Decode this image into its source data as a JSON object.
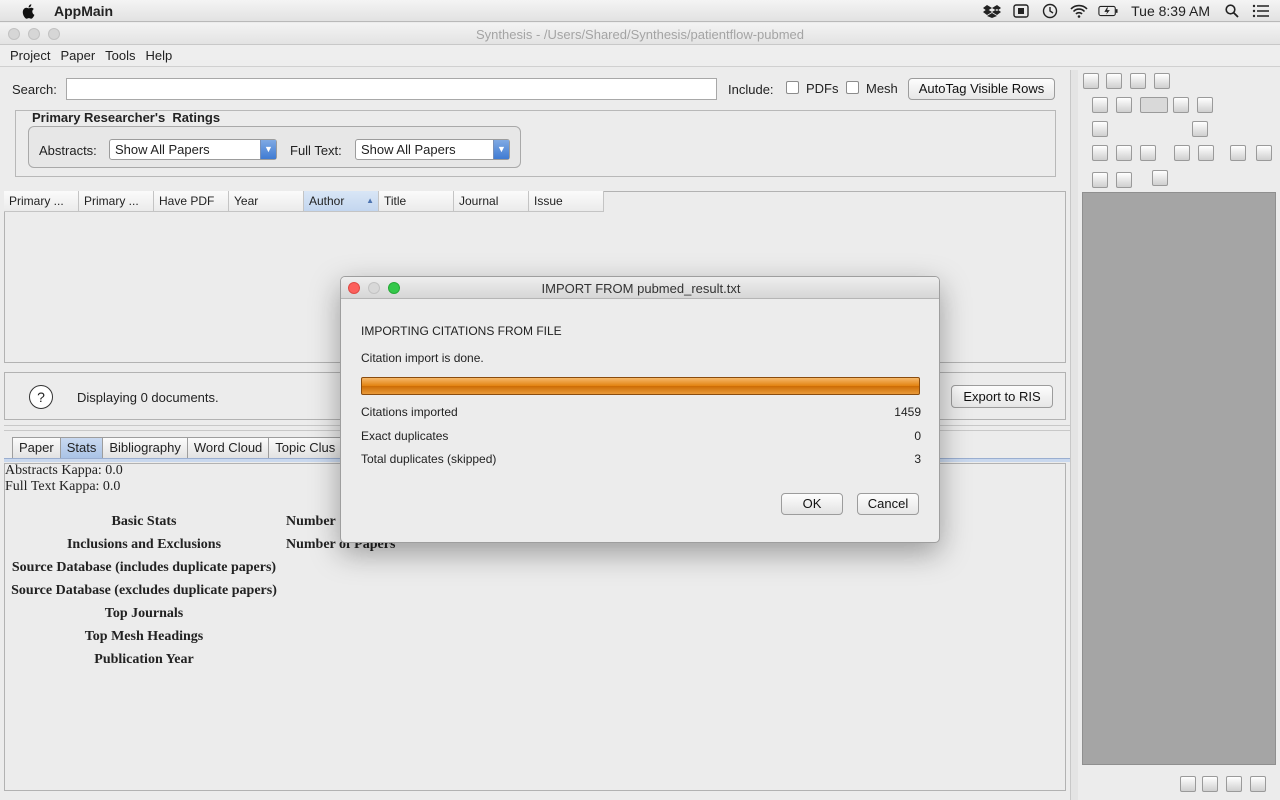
{
  "menubar": {
    "app_name": "AppMain",
    "clock": "Tue 8:39 AM"
  },
  "window": {
    "title": "Synthesis - /Users/Shared/Synthesis/patientflow-pubmed"
  },
  "app_menu": {
    "items": [
      "Project",
      "Paper",
      "Tools",
      "Help"
    ]
  },
  "search": {
    "label": "Search:",
    "value": "",
    "include_label": "Include:",
    "pdfs_label": "PDFs",
    "mesh_label": "Mesh",
    "autotag_button": "AutoTag Visible Rows"
  },
  "ratings": {
    "title": "Primary Researcher's  Ratings",
    "abstracts_label": "Abstracts:",
    "abstracts_value": "Show All Papers",
    "fulltext_label": "Full Text:",
    "fulltext_value": "Show All Papers"
  },
  "table": {
    "columns": [
      "Primary ...",
      "Primary ...",
      "Have PDF",
      "Year",
      "Author",
      "Title",
      "Journal",
      "Issue"
    ]
  },
  "status": {
    "help_symbol": "?",
    "text": "Displaying 0 documents.",
    "export_button": "Export to RIS"
  },
  "tabs": [
    "Paper",
    "Stats",
    "Bibliography",
    "Word Cloud",
    "Topic Clus"
  ],
  "stats": {
    "abstracts_kappa": "Abstracts Kappa: 0.0",
    "fulltext_kappa": "Full Text Kappa: 0.0",
    "rows": [
      "Basic Stats",
      "Inclusions and Exclusions",
      "Source Database (includes duplicate papers)",
      "Source Database (excludes duplicate papers)",
      "Top Journals",
      "Top Mesh Headings",
      "Publication Year"
    ],
    "col2_row1": "Number",
    "col2_row2": "Number of Papers"
  },
  "dialog": {
    "title": "IMPORT FROM pubmed_result.txt",
    "heading": "IMPORTING CITATIONS FROM FILE",
    "message": "Citation import is done.",
    "progress": 1.0,
    "rows": [
      {
        "label": "Citations imported",
        "value": "1459"
      },
      {
        "label": "Exact duplicates",
        "value": "0"
      },
      {
        "label": "Total duplicates (skipped)",
        "value": "3"
      }
    ],
    "ok_button": "OK",
    "cancel_button": "Cancel"
  }
}
